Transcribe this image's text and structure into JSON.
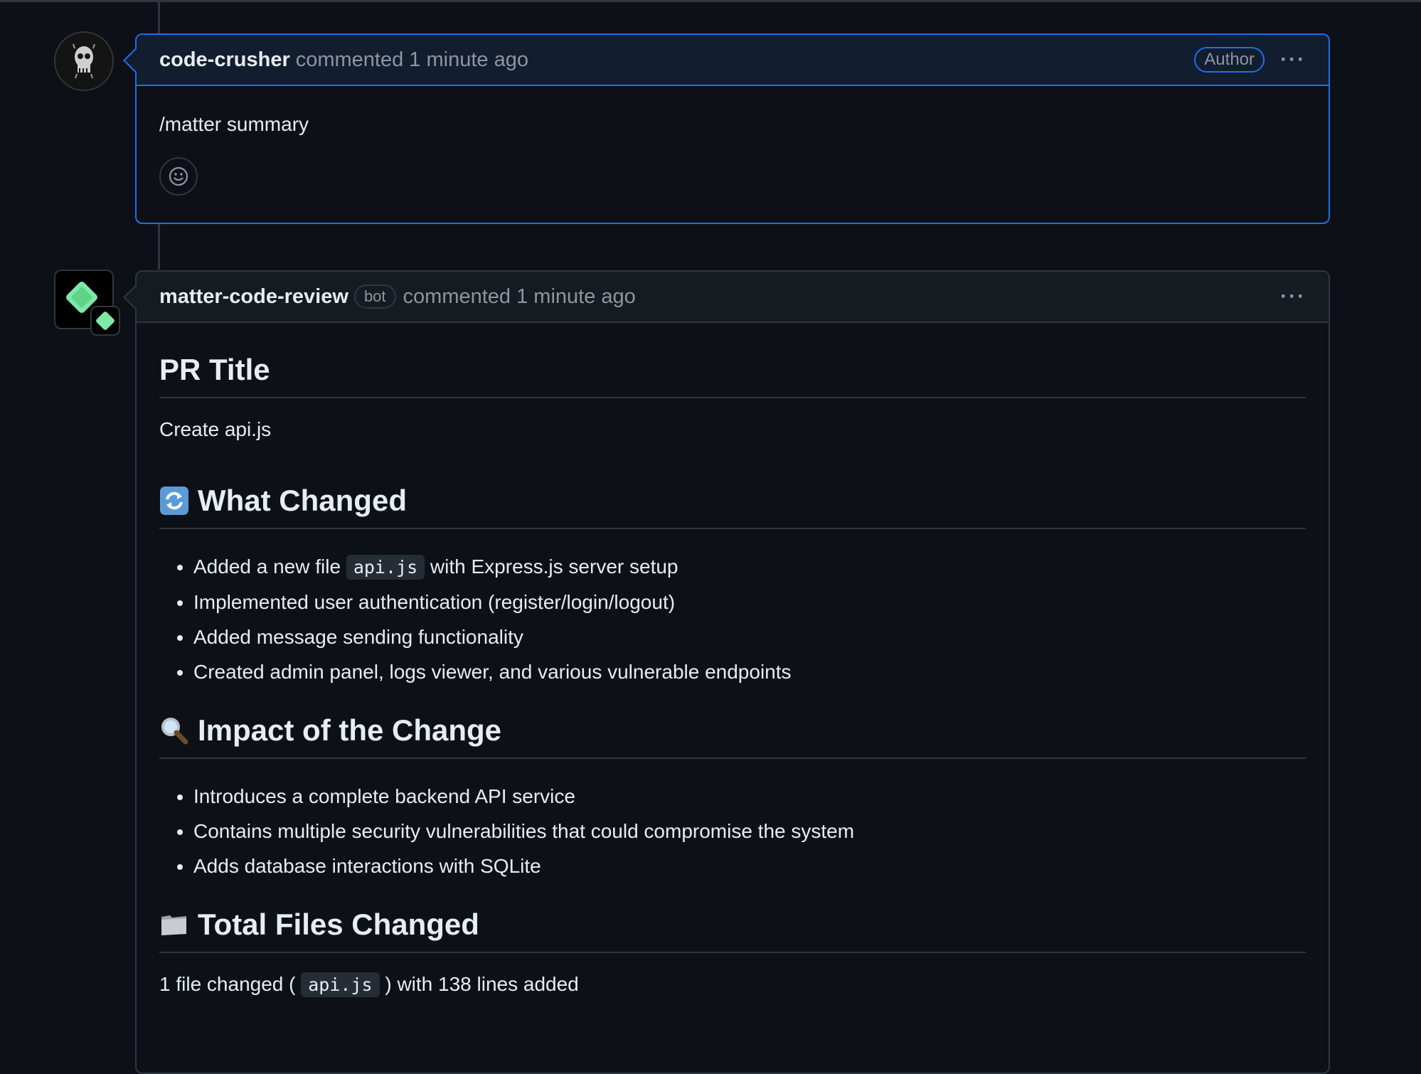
{
  "comments": [
    {
      "author": "code-crusher",
      "action": "commented 1 minute ago",
      "badge": "Author",
      "body": "/matter summary",
      "menu": "···"
    },
    {
      "author": "matter-code-review",
      "bot_label": "bot",
      "action": "commented 1 minute ago",
      "menu": "···",
      "sections": {
        "pr_title": {
          "heading": "PR Title",
          "text": "Create api.js"
        },
        "what_changed": {
          "icon": "arrows-counterclockwise-icon",
          "heading": "What Changed",
          "item1_pre": "Added a new file",
          "item1_code": "api.js",
          "item1_post": "with Express.js server setup",
          "item2": "Implemented user authentication (register/login/logout)",
          "item3": "Added message sending functionality",
          "item4": "Created admin panel, logs viewer, and various vulnerable endpoints"
        },
        "impact": {
          "icon": "magnifying-glass-icon",
          "heading": "Impact of the Change",
          "item1": "Introduces a complete backend API service",
          "item2": "Contains multiple security vulnerabilities that could compromise the system",
          "item3": "Adds database interactions with SQLite"
        },
        "files": {
          "icon": "folder-icon",
          "heading": "Total Files Changed",
          "pre": "1 file changed (",
          "code": "api.js",
          "post": ") with 138 lines added"
        }
      }
    }
  ],
  "colors": {
    "background": "#0d1117",
    "border": "#30363d",
    "accent_blue": "#1f6feb",
    "muted": "#8d96a0",
    "bot_green": "#7ee8a6"
  }
}
